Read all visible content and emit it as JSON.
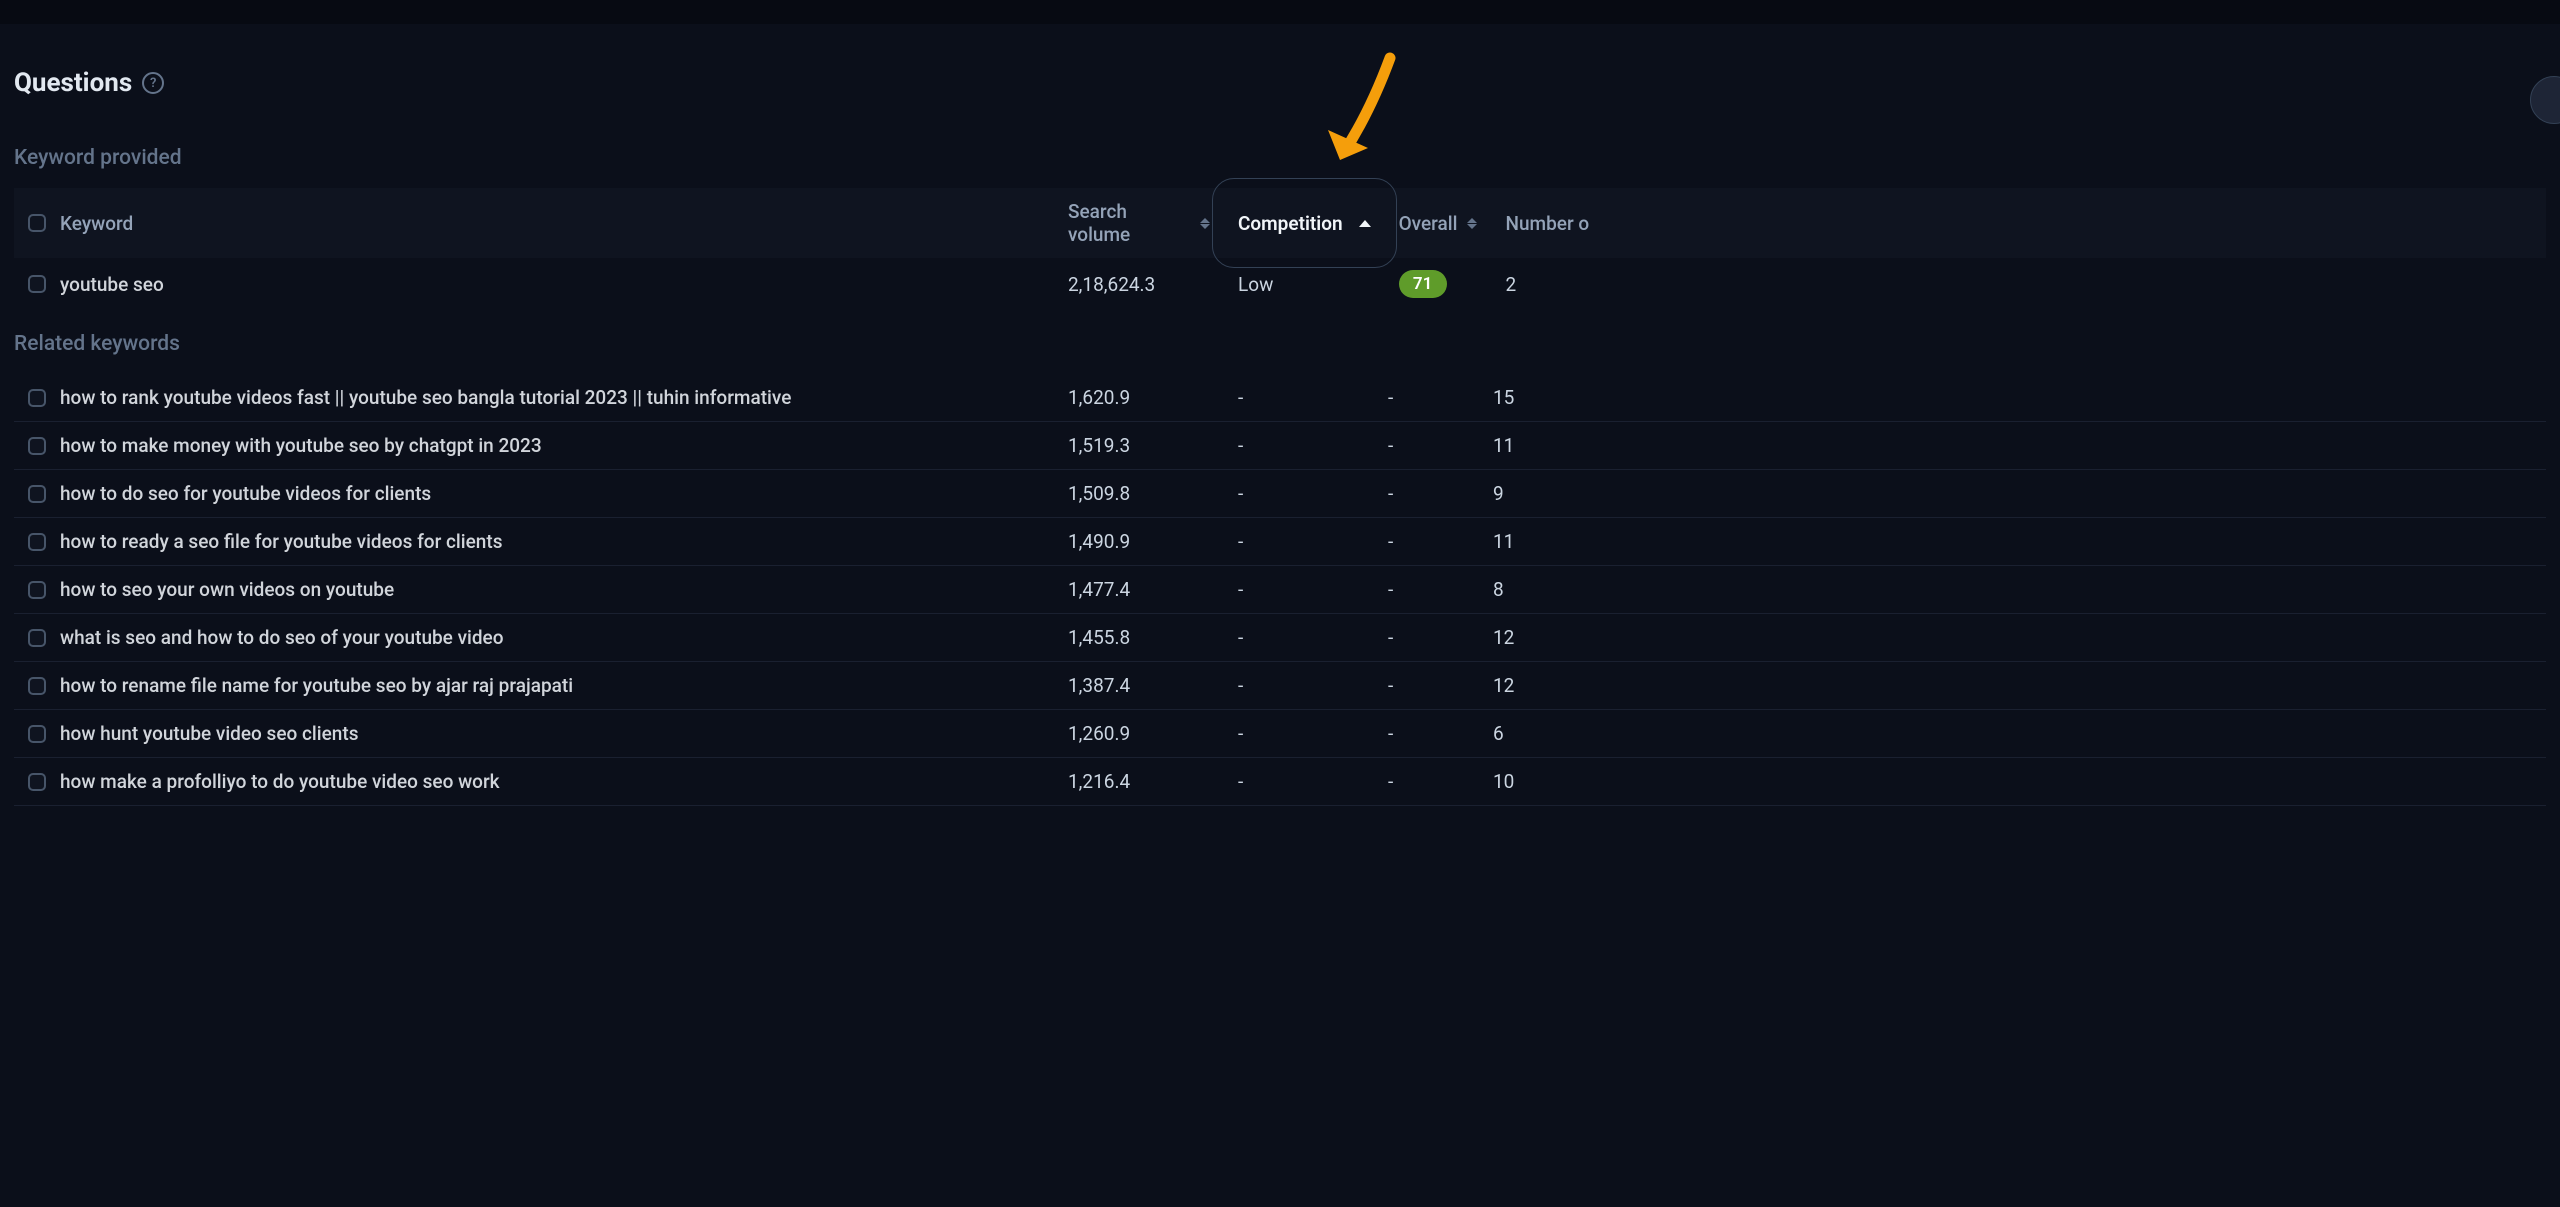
{
  "page": {
    "title": "Questions",
    "help_tooltip": "?"
  },
  "sections": {
    "provided_label": "Keyword provided",
    "related_label": "Related keywords"
  },
  "columns": {
    "keyword": "Keyword",
    "search_volume": "Search volume",
    "competition": "Competition",
    "overall": "Overall",
    "number_of": "Number o"
  },
  "provided": [
    {
      "keyword": "youtube seo",
      "volume": "2,18,624.3",
      "competition": "Low",
      "overall": "71",
      "overall_color": "green",
      "number": "2"
    }
  ],
  "related": [
    {
      "keyword": "how to rank youtube videos fast || youtube seo bangla tutorial 2023 || tuhin informative",
      "volume": "1,620.9",
      "competition": "-",
      "overall": "-",
      "number": "15"
    },
    {
      "keyword": "how to make money with youtube seo by chatgpt in 2023",
      "volume": "1,519.3",
      "competition": "-",
      "overall": "-",
      "number": "11"
    },
    {
      "keyword": "how to do seo for youtube videos for clients",
      "volume": "1,509.8",
      "competition": "-",
      "overall": "-",
      "number": "9"
    },
    {
      "keyword": "how to ready a seo file for youtube videos for clients",
      "volume": "1,490.9",
      "competition": "-",
      "overall": "-",
      "number": "11"
    },
    {
      "keyword": "how to seo your own videos on youtube",
      "volume": "1,477.4",
      "competition": "-",
      "overall": "-",
      "number": "8"
    },
    {
      "keyword": "what is seo and how to do seo of your youtube video",
      "volume": "1,455.8",
      "competition": "-",
      "overall": "-",
      "number": "12"
    },
    {
      "keyword": "how to rename file name for youtube seo by ajar raj prajapati",
      "volume": "1,387.4",
      "competition": "-",
      "overall": "-",
      "number": "12"
    },
    {
      "keyword": "how hunt youtube video seo clients",
      "volume": "1,260.9",
      "competition": "-",
      "overall": "-",
      "number": "6"
    },
    {
      "keyword": "how make a profolliyo to do youtube video seo work",
      "volume": "1,216.4",
      "competition": "-",
      "overall": "-",
      "number": "10"
    }
  ]
}
